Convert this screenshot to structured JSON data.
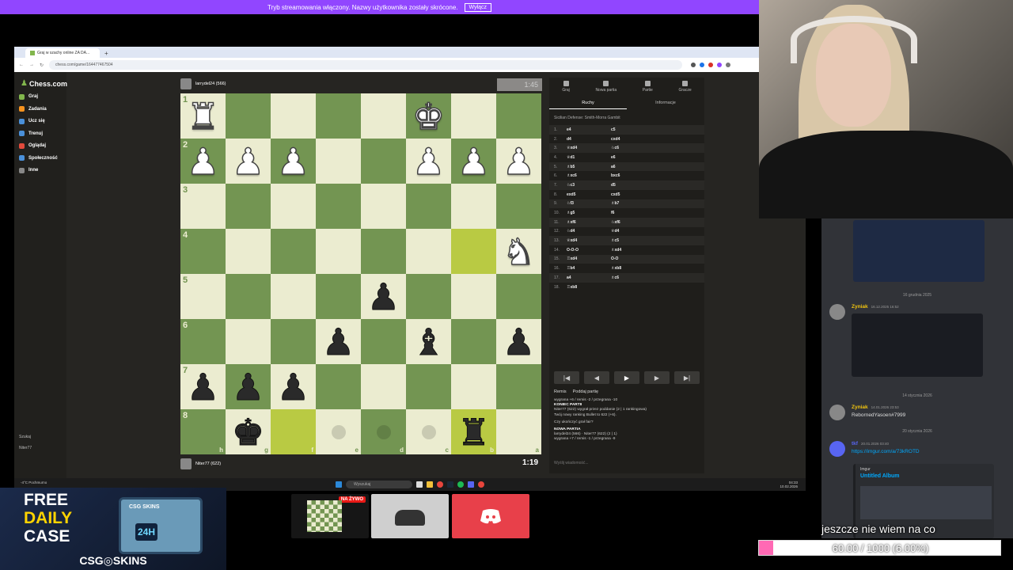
{
  "banner": {
    "text": "Tryb streamowania włączony. Nazwy użytkownika zostały skrócone.",
    "button": "Wyłącz"
  },
  "browser": {
    "tab_title": "Graj w szachy online ZA DA...",
    "new_tab": "+",
    "url": "chess.com/game/164477467504"
  },
  "sidebar": {
    "logo": "Chess.com",
    "items": [
      {
        "label": "Graj",
        "color": "#81b64c"
      },
      {
        "label": "Zadania",
        "color": "#f7931e"
      },
      {
        "label": "Ucz się",
        "color": "#4a90d9"
      },
      {
        "label": "Trenuj",
        "color": "#4a90d9"
      },
      {
        "label": "Oglądaj",
        "color": "#e24a3c"
      },
      {
        "label": "Społeczność",
        "color": "#4a90d9"
      },
      {
        "label": "Inne",
        "color": "#888888"
      }
    ],
    "search": "Szukaj",
    "user": "Niter77"
  },
  "players": {
    "top": {
      "name": "larrydel24 (566)",
      "clock": "1:45"
    },
    "bottom": {
      "name": "Niter77 (622)",
      "clock": "1:19"
    }
  },
  "board": {
    "ranks": [
      "1",
      "2",
      "3",
      "4",
      "5",
      "6",
      "7",
      "8"
    ],
    "files": [
      "h",
      "g",
      "f",
      "e",
      "d",
      "c",
      "b",
      "a"
    ],
    "pieces": [
      [
        "♜",
        "",
        "",
        "",
        "",
        "♚",
        "",
        ""
      ],
      [
        "♟",
        "♟",
        "♟",
        "",
        "",
        "♟",
        "♟",
        "♟"
      ],
      [
        "",
        "",
        "",
        "",
        "",
        "",
        "",
        ""
      ],
      [
        "",
        "",
        "",
        "",
        "",
        "",
        "",
        "♞"
      ],
      [
        "",
        "",
        "",
        "",
        "♟",
        "",
        "",
        ""
      ],
      [
        "",
        "",
        "",
        "♟",
        "",
        "♝",
        "",
        "♟"
      ],
      [
        "♟",
        "♟",
        "♟",
        "",
        "",
        "",
        "",
        ""
      ],
      [
        "",
        "♚",
        "",
        "",
        "",
        "",
        "♜",
        ""
      ]
    ],
    "colors": [
      [
        "w",
        "",
        "",
        "",
        "",
        "w",
        "",
        ""
      ],
      [
        "w",
        "w",
        "w",
        "",
        "",
        "w",
        "w",
        "w"
      ],
      [
        "",
        "",
        "",
        "",
        "",
        "",
        "",
        ""
      ],
      [
        "",
        "",
        "",
        "",
        "",
        "",
        "",
        "w"
      ],
      [
        "",
        "",
        "",
        "",
        "b",
        "",
        "",
        ""
      ],
      [
        "",
        "",
        "",
        "b",
        "",
        "b",
        "",
        "b"
      ],
      [
        "b",
        "b",
        "b",
        "",
        "",
        "",
        "",
        ""
      ],
      [
        "",
        "b",
        "",
        "",
        "",
        "",
        "b",
        ""
      ]
    ],
    "highlights": [
      "3,6",
      "7,2",
      "7,6"
    ],
    "hints": [
      "7,3",
      "7,4",
      "7,5"
    ]
  },
  "panel": {
    "tabs": [
      "Graj",
      "Nowa partia",
      "Partie",
      "Gracze"
    ],
    "subtabs": [
      "Ruchy",
      "Informacje"
    ],
    "opening": "Sicilian Defense: Smith-Morra Gambit",
    "moves": [
      [
        "1.",
        "e4",
        "c5"
      ],
      [
        "2.",
        "d4",
        "cxd4"
      ],
      [
        "3.",
        "♕xd4",
        "♘c6"
      ],
      [
        "4.",
        "♕d1",
        "e6"
      ],
      [
        "5.",
        "♗b5",
        "a6"
      ],
      [
        "6.",
        "♗xc6",
        "bxc6"
      ],
      [
        "7.",
        "♘c3",
        "d5"
      ],
      [
        "8.",
        "exd5",
        "cxd5"
      ],
      [
        "9.",
        "♘f3",
        "♗b7"
      ],
      [
        "10.",
        "♗g5",
        "f6"
      ],
      [
        "11.",
        "♗xf6",
        "♘xf6"
      ],
      [
        "12.",
        "♘d4",
        "♕d4"
      ],
      [
        "13.",
        "♕xd4",
        "♗c5"
      ],
      [
        "14.",
        "O-O-O",
        "♗xd4"
      ],
      [
        "15.",
        "♖xd4",
        "O-O"
      ],
      [
        "16.",
        "♖b4",
        "♗xb8"
      ],
      [
        "17.",
        "a4",
        "♗c6"
      ],
      [
        "18.",
        "♖xb8",
        ""
      ]
    ],
    "controls": [
      "|◀",
      "◀",
      "▶",
      "▶",
      "▶|"
    ],
    "actions": [
      "Remis",
      "Poddaj partię"
    ],
    "chat": [
      "wygrana +6 / remis -2 / przegrana -10",
      "KONIEC PARTII",
      "Niter77 (622) wygrał przez poddanie (2 | 1 rankingowa)",
      "Twój nowy ranking Bullet to 622 (+6).",
      "Czy ukończyć grał fair?",
      "NOWA PARTIA",
      "larrydel24 (566) · Niter77 (622) (2 | 1)",
      "wygrana +7 / remis -1 / przegrana -9"
    ],
    "message_placeholder": "Wyślij wiadomość..."
  },
  "taskbar": {
    "search": "Wyszukaj",
    "weather": "-4°C Pochmurno",
    "time": "04:33",
    "date": "10.02.2026"
  },
  "discord": {
    "dates": [
      "16 grudnia 2025",
      "14 stycznia 2026",
      "20 stycznia 2026"
    ],
    "messages": [
      {
        "user": "Zyniak",
        "time": "16.12.2025 16:52",
        "text": ""
      },
      {
        "user": "Zyniak",
        "time": "14.01.2026 23:53",
        "text": "RebornedYasoen#7999"
      },
      {
        "user": "tkf",
        "time": "20.01.2026 03:40",
        "text": "https://imgur.com/a/73kROTD"
      }
    ],
    "embed_source": "Imgur",
    "embed_title": "Untitled Album"
  },
  "overlay": {
    "subtitle": "jeszcze nie wiem na co",
    "goal_text": "60.00 / 1000 (6.00%)",
    "goal_fraction": 0.06
  },
  "ad": {
    "line1": "FREE",
    "line2": "DAILY",
    "line3": "CASE",
    "box_label": "CSG SKINS",
    "box_badge": "24H",
    "brand": "CSG◎SKINS"
  },
  "thumbs": {
    "live": "NA ŻYWO"
  }
}
